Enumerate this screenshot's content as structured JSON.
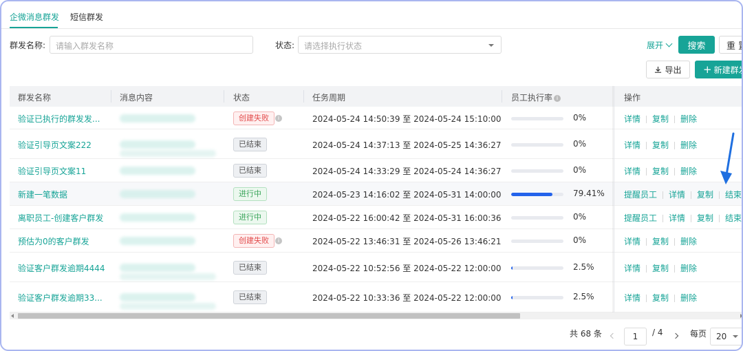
{
  "tabs": [
    {
      "label": "企微消息群发",
      "active": true
    },
    {
      "label": "短信群发",
      "active": false
    }
  ],
  "filters": {
    "name_label": "群发名称:",
    "name_placeholder": "请输入群发名称",
    "status_label": "状态:",
    "status_placeholder": "请选择执行状态",
    "expand_label": "展开",
    "search_label": "搜索",
    "reset_label": "重 置"
  },
  "toolbar": {
    "export_label": "导出",
    "new_label": "新建群发"
  },
  "table": {
    "columns": [
      "群发名称",
      "消息内容",
      "状态",
      "任务周期",
      "员工执行率",
      "操作"
    ],
    "rows": [
      {
        "name": "验证已执行的群发发...",
        "status": "创建失败",
        "status_type": "fail",
        "status_info": true,
        "period": "2024-05-24 14:50:39 至 2024-05-24 15:10:00",
        "rate": 0,
        "rate_label": "0%",
        "ops": [
          "详情",
          "复制",
          "删除"
        ]
      },
      {
        "name": "验证引导页文案222",
        "status": "已结束",
        "status_type": "done",
        "status_info": false,
        "period": "2024-05-24 14:37:13 至 2024-05-25 14:36:27",
        "rate": 0,
        "rate_label": "0%",
        "ops": [
          "详情",
          "复制",
          "删除"
        ]
      },
      {
        "name": "验证引导页文案11",
        "status": "已结束",
        "status_type": "done",
        "status_info": false,
        "period": "2024-05-24 14:33:29 至 2024-05-24 14:36:27",
        "rate": 0,
        "rate_label": "0%",
        "ops": [
          "详情",
          "复制",
          "删除"
        ]
      },
      {
        "name": "新建一笔数据",
        "status": "进行中",
        "status_type": "run",
        "status_info": false,
        "period": "2024-05-23 14:16:02 至 2024-05-31 14:00:00",
        "rate": 79.41,
        "rate_label": "79.41%",
        "ops": [
          "提醒员工",
          "详情",
          "复制",
          "结束"
        ]
      },
      {
        "name": "离职员工-创建客户群发",
        "status": "进行中",
        "status_type": "run",
        "status_info": false,
        "period": "2024-05-22 16:00:42 至 2024-05-31 16:00:36",
        "rate": 0,
        "rate_label": "0%",
        "ops": [
          "提醒员工",
          "详情",
          "复制",
          "结束"
        ]
      },
      {
        "name": "预估为0的客户群发",
        "status": "创建失败",
        "status_type": "fail",
        "status_info": true,
        "period": "2024-05-22 13:46:31 至 2024-05-26 13:46:21",
        "rate": 0,
        "rate_label": "0%",
        "ops": [
          "详情",
          "复制",
          "删除"
        ]
      },
      {
        "name": "验证客户群发逾期4444",
        "status": "已结束",
        "status_type": "done",
        "status_info": false,
        "period": "2024-05-22 10:52:56 至 2024-05-22 12:00:00",
        "rate": 2.5,
        "rate_label": "2.5%",
        "ops": [
          "详情",
          "复制",
          "删除"
        ]
      },
      {
        "name": "验证客户群发逾期33...",
        "status": "已结束",
        "status_type": "done",
        "status_info": false,
        "period": "2024-05-22 10:33:36 至 2024-05-22 12:00:00",
        "rate": 2.5,
        "rate_label": "2.5%",
        "ops": [
          "详情",
          "复制",
          "删除"
        ]
      }
    ]
  },
  "pagination": {
    "total_label": "共 68 条",
    "current_page": "1",
    "total_pages": "/ 4",
    "per_page_label": "每页",
    "per_page_value": "20"
  },
  "colors": {
    "brand": "#17a497",
    "progress": "#2463eb",
    "annotation_arrow": "#1f6fe0"
  },
  "icons": [
    "download-icon",
    "plus-icon",
    "info-icon",
    "chevron-down-icon",
    "chevron-left-icon",
    "chevron-right-icon",
    "annotation-arrow-icon"
  ]
}
